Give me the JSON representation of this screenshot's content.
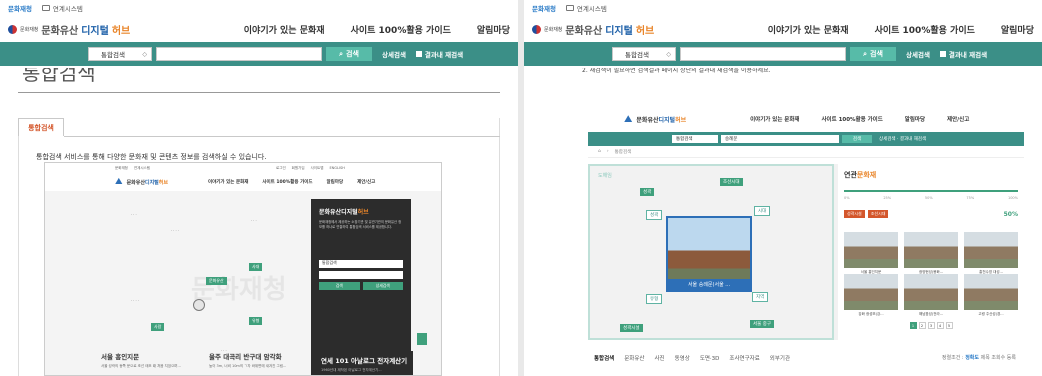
{
  "left": {
    "top_links": [
      "문화재청",
      "연계시스템"
    ],
    "logo": {
      "agency": "문화재청",
      "brand_a": "문화유산",
      "brand_b": "디지털",
      "brand_c": "허브"
    },
    "menu": [
      "이야기가 있는 문화재",
      "사이트 100%활용 가이드",
      "알림마당"
    ],
    "search": {
      "select": "통합검색",
      "button": "검색",
      "advanced": "상세검색",
      "research": "결과내 재검색"
    },
    "page_title": "통합검색",
    "tab": "통합검색",
    "description": "통합검색 서비스를 통해 다양한 문화재 및 콘텐츠 정보를 검색하실 수 있습니다.",
    "mini": {
      "top_links": [
        "문화재청",
        "연계시스템",
        "로그인",
        "회원가입",
        "사이트맵",
        "ENGLISH"
      ],
      "menu": [
        "이야기가 있는 문화재",
        "사이트 100%활용 가이드",
        "알림마당",
        "제안/신고"
      ],
      "hubs": [
        "문화유산",
        "사람",
        "사대",
        "유형"
      ],
      "bg_word": "문화재청",
      "dark": {
        "title_a": "문화유산디지털",
        "title_b": "허브",
        "desc": "문화재청에서 제공하는 소장기관 및 유관기관의 문화유산 정보를 하나로 연결하여 통합검색 서비스를 제공합니다.",
        "select": "통합검색",
        "btn1": "검색",
        "btn2": "상세검색"
      },
      "cards": [
        {
          "title": "서울 흥인지문",
          "sub": "서울 성곽의 동쪽 문으로 조선 태조 때 처음 지었으며..."
        },
        {
          "title": "울주 대곡리 반구대 암각화",
          "sub": "높이 3m, 너비 10m의 ㄱ자 바위면에 새겨진 그림..."
        },
        {
          "title": "연세 101 아날로그 전자계산기",
          "sub": "1960년대 제작된 아날로그 전자계산기..."
        }
      ]
    }
  },
  "right": {
    "top_links": [
      "문화재청",
      "연계시스템"
    ],
    "logo": {
      "agency": "문화재청",
      "brand_a": "문화유산",
      "brand_b": "디지털",
      "brand_c": "허브"
    },
    "menu": [
      "이야기가 있는 문화재",
      "사이트 100%활용 가이드",
      "알림마당"
    ],
    "search": {
      "select": "통합검색",
      "button": "검색",
      "advanced": "상세검색",
      "research": "결과내 재검색"
    },
    "notice": "2. 재검색이 필요하면 검색결과 페이지 상단의 결과내 재검색을 이용하세요.",
    "shot": {
      "menu": [
        "이야기가 있는 문화재",
        "사이트 100%활용 가이드",
        "알림마당",
        "제안/신고"
      ],
      "search_select": "통합검색",
      "search_value": "숭례문",
      "search_btn": "검색",
      "search_links": "상세검색 ·  결과내 재검색",
      "breadcrumb": "통합검색",
      "graph_label": "도해임",
      "nodes": [
        "조선시대",
        "성곽",
        "성곽",
        "시대",
        "유형",
        "지역",
        "성곽시설",
        "서울 중구"
      ],
      "center_caption": "서울 숭례문(서울 ...",
      "side_title_a": "연관",
      "side_title_b": "문화재",
      "ticks": [
        "0%",
        "25%",
        "50%",
        "75%",
        "100%"
      ],
      "chips": [
        "성곽시설",
        "조선시대"
      ],
      "percent": "50%",
      "thumbs": [
        "서울 흥인지문",
        "광양현성(봉화...",
        "홍천수영 대성...",
        "강화 광성보(강...",
        "해남읍성(전라...",
        "고령 주산성(경..."
      ],
      "pages": [
        "1",
        "2",
        "3",
        "4",
        "5"
      ],
      "tabs": [
        "통합검색",
        "문화유산",
        "사진",
        "동영상",
        "도면·3D",
        "조사연구자료",
        "외부기관"
      ],
      "sort_label": "정렬조건 :",
      "sort_active": "정확도",
      "sort_other": "제목  조회수  등록"
    }
  }
}
